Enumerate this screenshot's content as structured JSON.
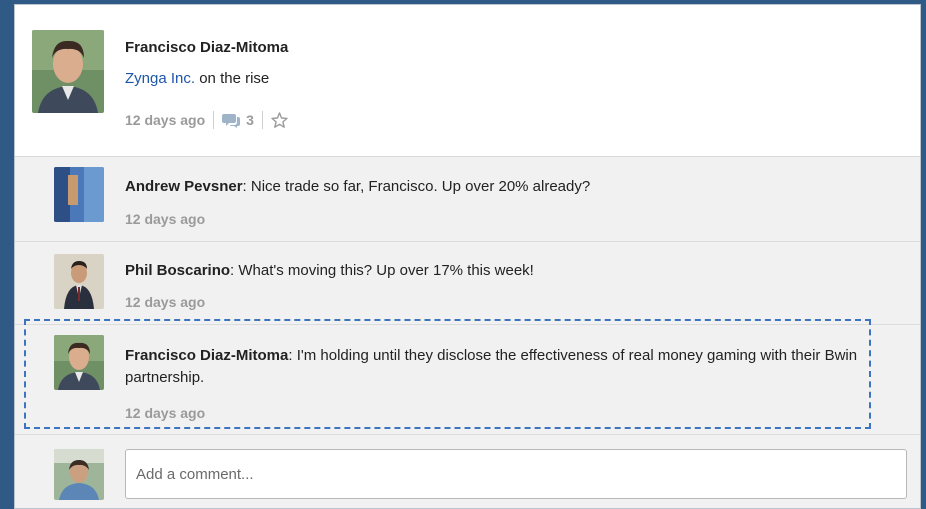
{
  "post": {
    "author": "Francisco Diaz-Mitoma",
    "link_text": "Zynga Inc.",
    "body_text": " on the rise",
    "time": "12 days ago",
    "comment_count": "3",
    "icons": [
      "avatar-photo",
      "comment-bubble-icon",
      "star-icon"
    ]
  },
  "comments": [
    {
      "author": "Andrew Pevsner",
      "text": ": Nice trade so far, Francisco. Up over 20% already?",
      "time": "12 days ago"
    },
    {
      "author": "Phil Boscarino",
      "text": ": What's moving this? Up over 17% this week!",
      "time": "12 days ago"
    },
    {
      "author": "Francisco Diaz-Mitoma",
      "text": ": I'm holding until they disclose the effectiveness of real money gaming with their Bwin partnership.",
      "time": "12 days ago"
    }
  ],
  "add_comment": {
    "placeholder": "Add a comment..."
  },
  "colors": {
    "background": "#2f5a86",
    "link": "#1f56a8",
    "highlight_border": "#3c74bf",
    "meta_text": "#9a9a9a"
  }
}
